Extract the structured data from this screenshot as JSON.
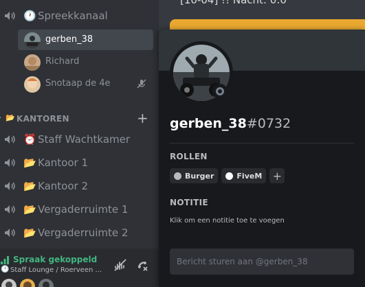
{
  "sidebar": {
    "voice_channels": [
      {
        "emoji": "🕐",
        "name": "Spreekkanaal"
      },
      {
        "emoji": "⏰",
        "name": "Staff Wachtkamer"
      },
      {
        "emoji": "📂",
        "name": "Kantoor 1"
      },
      {
        "emoji": "📂",
        "name": "Kantoor 2"
      },
      {
        "emoji": "📂",
        "name": "Vergaderruimte 1"
      },
      {
        "emoji": "📂",
        "name": "Vergaderruimte 2"
      }
    ],
    "connected_users": [
      {
        "name": "gerben_38",
        "active": true,
        "muted": false
      },
      {
        "name": "Richard",
        "active": false,
        "muted": false
      },
      {
        "name": "Snotaap de 4e",
        "active": false,
        "muted": true
      }
    ],
    "category": {
      "emoji": "📂",
      "name": "KANTOREN",
      "add": "+"
    }
  },
  "voice_panel": {
    "status": "Spraak gekoppeld",
    "clock_emoji": "🕐",
    "channel": "Staff Lounge / Roerveen ..."
  },
  "main": {
    "top_text": "[10-04] !! Nacht: 0:0"
  },
  "profile": {
    "username": "gerben_38",
    "discriminator": "#0732",
    "roles_title": "ROLLEN",
    "roles": [
      {
        "name": "Burger",
        "color": "#b9bbbe"
      },
      {
        "name": "FiveM",
        "color": "#ffffff"
      }
    ],
    "role_add": "+",
    "note_title": "NOTITIE",
    "note_placeholder": "Klik om een notitie toe te voegen",
    "message_placeholder": "Bericht sturen aan @gerben_38",
    "status": "offline"
  },
  "colors": {
    "accent_yellow": "#e9a930",
    "voice_green": "#43b581",
    "sidebar_bg": "#2f3136",
    "popout_bg": "#18191c"
  },
  "icons": {
    "voice_channel": "speaker-icon",
    "muted": "mic-muted-icon",
    "signal": "signal-bars-icon",
    "noise_suppression": "noise-suppression-icon",
    "disconnect": "phone-disconnect-icon"
  }
}
